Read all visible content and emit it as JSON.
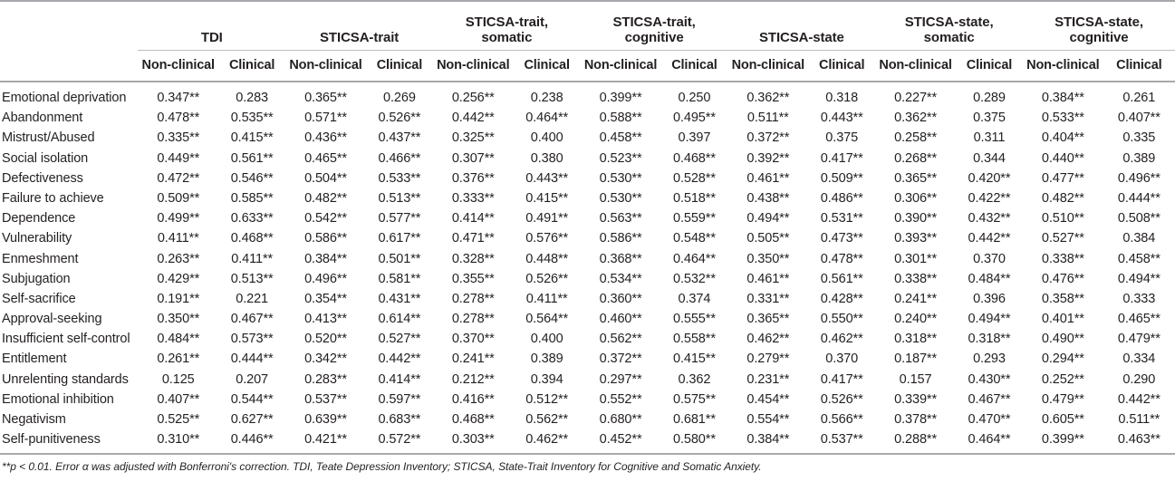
{
  "table": {
    "row_label_header": "",
    "groups": [
      {
        "name": "TDI",
        "lines": [
          "TDI"
        ]
      },
      {
        "name": "STICSA-trait",
        "lines": [
          "STICSA-trait"
        ]
      },
      {
        "name": "STICSA-trait, somatic",
        "lines": [
          "STICSA-trait,",
          "somatic"
        ]
      },
      {
        "name": "STICSA-trait, cognitive",
        "lines": [
          "STICSA-trait,",
          "cognitive"
        ]
      },
      {
        "name": "STICSA-state",
        "lines": [
          "STICSA-state"
        ]
      },
      {
        "name": "STICSA-state, somatic",
        "lines": [
          "STICSA-state,",
          "somatic"
        ]
      },
      {
        "name": "STICSA-state, cognitive",
        "lines": [
          "STICSA-state,",
          "cognitive"
        ]
      }
    ],
    "subheaders": [
      "Non-clinical",
      "Clinical",
      "Non-clinical",
      "Clinical",
      "Non-clinical",
      "Clinical",
      "Non-clinical",
      "Clinical",
      "Non-clinical",
      "Clinical",
      "Non-clinical",
      "Clinical",
      "Non-clinical",
      "Clinical"
    ],
    "rows": [
      {
        "label": "Emotional deprivation",
        "values": [
          "0.347**",
          "0.283",
          "0.365**",
          "0.269",
          "0.256**",
          "0.238",
          "0.399**",
          "0.250",
          "0.362**",
          "0.318",
          "0.227**",
          "0.289",
          "0.384**",
          "0.261"
        ]
      },
      {
        "label": "Abandonment",
        "values": [
          "0.478**",
          "0.535**",
          "0.571**",
          "0.526**",
          "0.442**",
          "0.464**",
          "0.588**",
          "0.495**",
          "0.511**",
          "0.443**",
          "0.362**",
          "0.375",
          "0.533**",
          "0.407**"
        ]
      },
      {
        "label": "Mistrust/Abused",
        "values": [
          "0.335**",
          "0.415**",
          "0.436**",
          "0.437**",
          "0.325**",
          "0.400",
          "0.458**",
          "0.397",
          "0.372**",
          "0.375",
          "0.258**",
          "0.311",
          "0.404**",
          "0.335"
        ]
      },
      {
        "label": "Social isolation",
        "values": [
          "0.449**",
          "0.561**",
          "0.465**",
          "0.466**",
          "0.307**",
          "0.380",
          "0.523**",
          "0.468**",
          "0.392**",
          "0.417**",
          "0.268**",
          "0.344",
          "0.440**",
          "0.389"
        ]
      },
      {
        "label": "Defectiveness",
        "values": [
          "0.472**",
          "0.546**",
          "0.504**",
          "0.533**",
          "0.376**",
          "0.443**",
          "0.530**",
          "0.528**",
          "0.461**",
          "0.509**",
          "0.365**",
          "0.420**",
          "0.477**",
          "0.496**"
        ]
      },
      {
        "label": "Failure to achieve",
        "values": [
          "0.509**",
          "0.585**",
          "0.482**",
          "0.513**",
          "0.333**",
          "0.415**",
          "0.530**",
          "0.518**",
          "0.438**",
          "0.486**",
          "0.306**",
          "0.422**",
          "0.482**",
          "0.444**"
        ]
      },
      {
        "label": "Dependence",
        "values": [
          "0.499**",
          "0.633**",
          "0.542**",
          "0.577**",
          "0.414**",
          "0.491**",
          "0.563**",
          "0.559**",
          "0.494**",
          "0.531**",
          "0.390**",
          "0.432**",
          "0.510**",
          "0.508**"
        ]
      },
      {
        "label": "Vulnerability",
        "values": [
          "0.411**",
          "0.468**",
          "0.586**",
          "0.617**",
          "0.471**",
          "0.576**",
          "0.586**",
          "0.548**",
          "0.505**",
          "0.473**",
          "0.393**",
          "0.442**",
          "0.527**",
          "0.384"
        ]
      },
      {
        "label": "Enmeshment",
        "values": [
          "0.263**",
          "0.411**",
          "0.384**",
          "0.501**",
          "0.328**",
          "0.448**",
          "0.368**",
          "0.464**",
          "0.350**",
          "0.478**",
          "0.301**",
          "0.370",
          "0.338**",
          "0.458**"
        ]
      },
      {
        "label": "Subjugation",
        "values": [
          "0.429**",
          "0.513**",
          "0.496**",
          "0.581**",
          "0.355**",
          "0.526**",
          "0.534**",
          "0.532**",
          "0.461**",
          "0.561**",
          "0.338**",
          "0.484**",
          "0.476**",
          "0.494**"
        ]
      },
      {
        "label": "Self-sacrifice",
        "values": [
          "0.191**",
          "0.221",
          "0.354**",
          "0.431**",
          "0.278**",
          "0.411**",
          "0.360**",
          "0.374",
          "0.331**",
          "0.428**",
          "0.241**",
          "0.396",
          "0.358**",
          "0.333"
        ]
      },
      {
        "label": "Approval-seeking",
        "values": [
          "0.350**",
          "0.467**",
          "0.413**",
          "0.614**",
          "0.278**",
          "0.564**",
          "0.460**",
          "0.555**",
          "0.365**",
          "0.550**",
          "0.240**",
          "0.494**",
          "0.401**",
          "0.465**"
        ]
      },
      {
        "label": "Insufficient self-control",
        "values": [
          "0.484**",
          "0.573**",
          "0.520**",
          "0.527**",
          "0.370**",
          "0.400",
          "0.562**",
          "0.558**",
          "0.462**",
          "0.462**",
          "0.318**",
          "0.318**",
          "0.490**",
          "0.479**"
        ]
      },
      {
        "label": "Entitlement",
        "values": [
          "0.261**",
          "0.444**",
          "0.342**",
          "0.442**",
          "0.241**",
          "0.389",
          "0.372**",
          "0.415**",
          "0.279**",
          "0.370",
          "0.187**",
          "0.293",
          "0.294**",
          "0.334"
        ]
      },
      {
        "label": "Unrelenting standards",
        "values": [
          "0.125",
          "0.207",
          "0.283**",
          "0.414**",
          "0.212**",
          "0.394",
          "0.297**",
          "0.362",
          "0.231**",
          "0.417**",
          "0.157",
          "0.430**",
          "0.252**",
          "0.290"
        ]
      },
      {
        "label": "Emotional inhibition",
        "values": [
          "0.407**",
          "0.544**",
          "0.537**",
          "0.597**",
          "0.416**",
          "0.512**",
          "0.552**",
          "0.575**",
          "0.454**",
          "0.526**",
          "0.339**",
          "0.467**",
          "0.479**",
          "0.442**"
        ]
      },
      {
        "label": "Negativism",
        "values": [
          "0.525**",
          "0.627**",
          "0.639**",
          "0.683**",
          "0.468**",
          "0.562**",
          "0.680**",
          "0.681**",
          "0.554**",
          "0.566**",
          "0.378**",
          "0.470**",
          "0.605**",
          "0.511**"
        ]
      },
      {
        "label": "Self-punitiveness",
        "values": [
          "0.310**",
          "0.446**",
          "0.421**",
          "0.572**",
          "0.303**",
          "0.462**",
          "0.452**",
          "0.580**",
          "0.384**",
          "0.537**",
          "0.288**",
          "0.464**",
          "0.399**",
          "0.463**"
        ]
      }
    ],
    "footnote": "**p < 0.01. Error α was adjusted with Bonferroni's correction. TDI, Teate Depression Inventory; STICSA, State-Trait Inventory for Cognitive and Somatic Anxiety."
  },
  "colors": {
    "rule": "#a7a9ac",
    "span_rule": "#bcbec0",
    "text": "#231f20",
    "background": "#ffffff"
  }
}
